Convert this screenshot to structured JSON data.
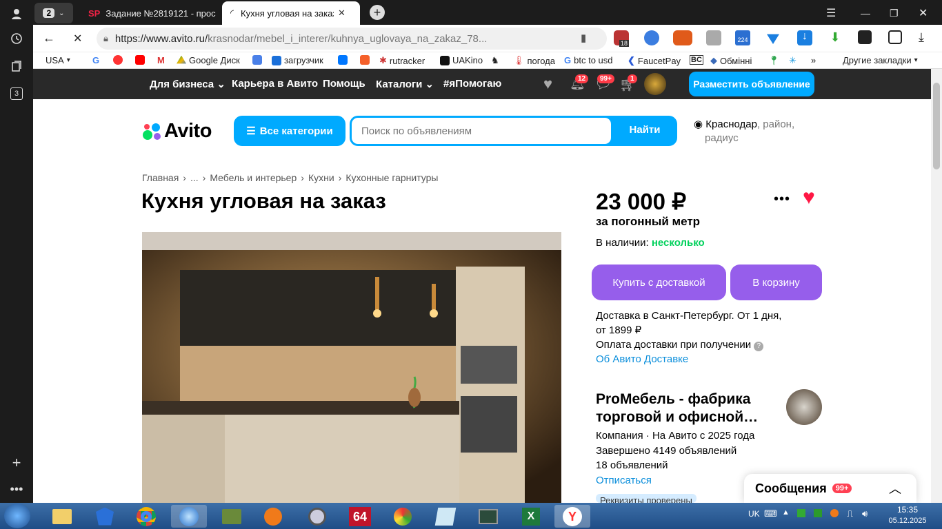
{
  "browser": {
    "tab_count": "2",
    "tabs": [
      {
        "label": "Задание №2819121 - прос"
      },
      {
        "label": "Кухня угловая на заказ"
      }
    ],
    "url_host": "https://www.avito.ru/",
    "url_path": "krasnodar/mebel_i_interer/kuhnya_uglovaya_na_zakaz_78...",
    "bookmarks": [
      "USA",
      "Google Диск",
      "загрузчик",
      "rutracker",
      "UAKino",
      "погода",
      "btc to usd",
      "FaucetPay",
      "Обмінні"
    ],
    "other_bookmarks": "Другие закладки",
    "ext_badges": [
      "18",
      "224"
    ],
    "rail_badge": "3"
  },
  "topnav": {
    "items": [
      "Для бизнеса",
      "Карьера в Авито",
      "Помощь",
      "Каталоги",
      "#яПомогаю"
    ],
    "badge_notif": "12",
    "badge_msg": "99+",
    "badge_cart": "1",
    "post_button": "Разместить объявление"
  },
  "header": {
    "logo": "Avito",
    "categories_button": "Все категории",
    "search_placeholder": "Поиск по объявлениям",
    "search_button": "Найти",
    "city": "Краснодар",
    "city_extra": ", район,",
    "city_extra2": "радиус"
  },
  "breadcrumb": [
    "Главная",
    "...",
    "Мебель и интерьер",
    "Кухни",
    "Кухонные гарнитуры"
  ],
  "listing": {
    "title": "Кухня угловая на заказ",
    "price": "23 000 ₽",
    "price_unit": "за погонный метр",
    "stock_label": "В наличии:",
    "stock_value": "несколько",
    "buy_button": "Купить с доставкой",
    "cart_button": "В корзину",
    "delivery_line1": "Доставка в Санкт-Петербург. От 1 дня,",
    "delivery_line2": "от 1899 ₽",
    "payment": "Оплата доставки при получении",
    "delivery_link": "Об Авито Доставке"
  },
  "seller": {
    "name_line1": "ProМебель - фабрика",
    "name_line2": "торговой и офисной…",
    "info1": "Компания · На Авито с 2025 года",
    "info2": "Завершено 4149 объявлений",
    "info3": "18 объявлений",
    "unsubscribe": "Отписаться",
    "verified": "Реквизиты проверены"
  },
  "messages": {
    "label": "Сообщения",
    "badge": "99+"
  },
  "taskbar": {
    "lang": "UK",
    "time": "15:35",
    "date": "05.12.2025"
  },
  "colors": {
    "accent": "#00aaff",
    "purple": "#965eeb",
    "green": "#02d15c",
    "topbar": "#292929"
  }
}
